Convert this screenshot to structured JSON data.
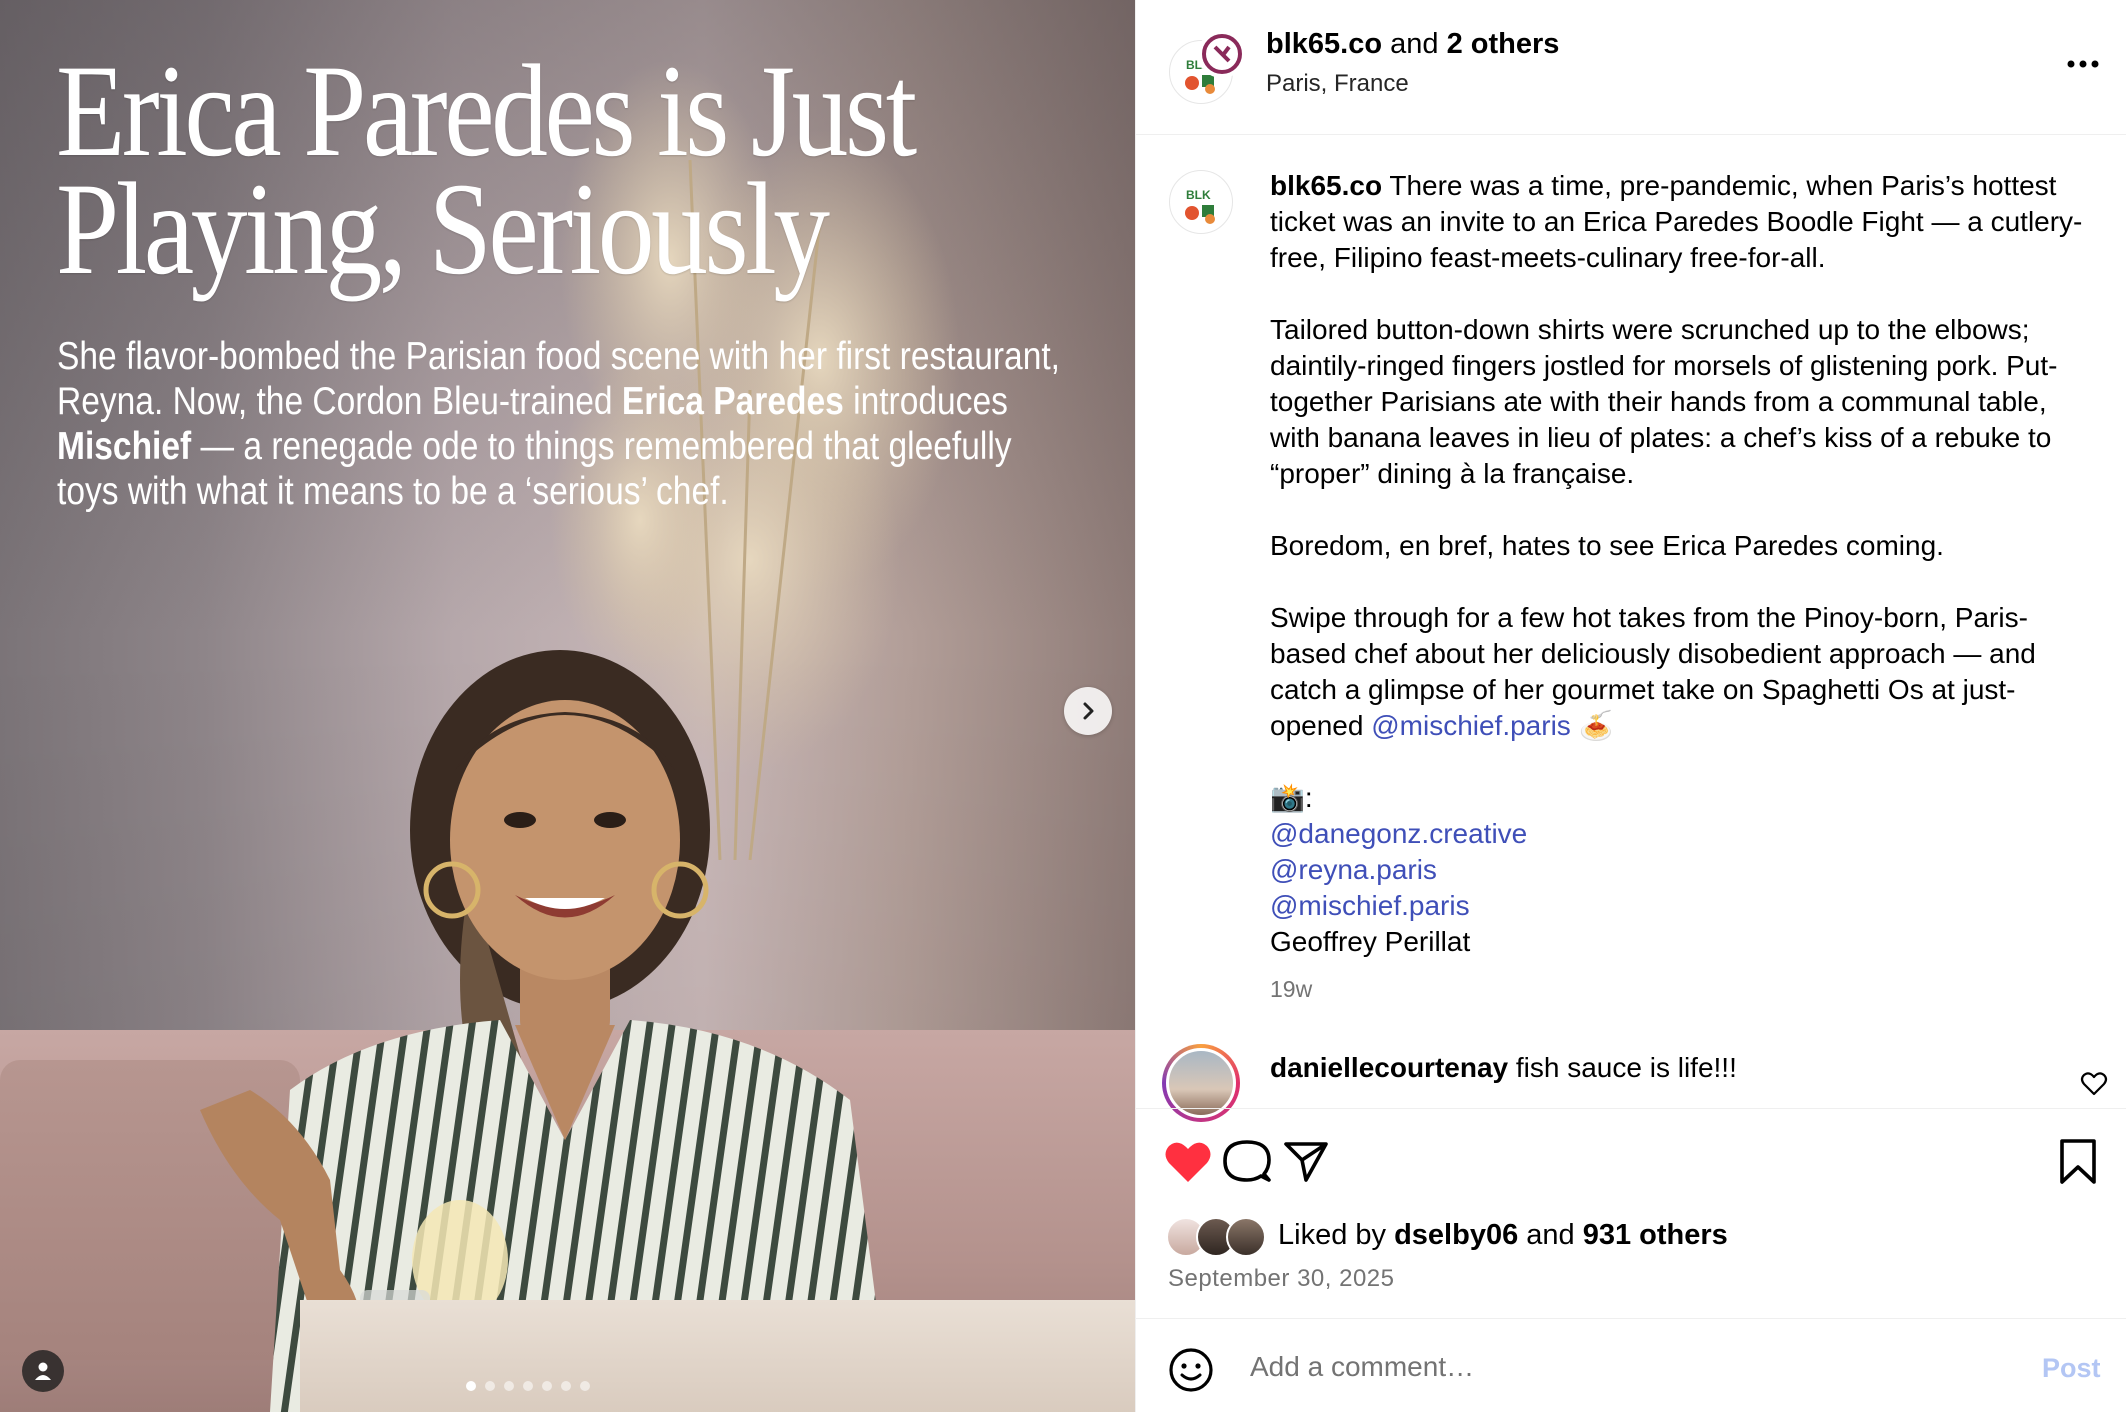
{
  "media": {
    "headline": "Erica Paredes is Just Playing, Seriously",
    "deck_parts": [
      "She flavor-bombed the Parisian food scene with her first restaurant, Reyna. Now, the Cordon Bleu-trained ",
      "Erica Paredes",
      " introduces ",
      "Mischief",
      " — a renegade ode to things remembered that gleefully toys with what it means to be a ‘serious’ chef."
    ],
    "carousel": {
      "total": 7,
      "active": 1
    }
  },
  "header": {
    "username": "blk65.co",
    "joiner": " and ",
    "others": "2 others",
    "location": "Paris, France",
    "avatar_text": "BLK"
  },
  "caption": {
    "username": "blk65.co",
    "paragraphs": [
      "There was a time, pre-pandemic, when Paris’s hottest ticket was an invite to an Erica Paredes Boodle Fight — a cutlery-free, Filipino feast-meets-culinary free-for-all.",
      "Tailored button-down shirts were scrunched up to the elbows; daintily-ringed fingers jostled for morsels of glistening pork. Put-together Parisians ate with their hands from a communal table, with banana leaves in lieu of plates: a chef’s kiss of a rebuke to “proper” dining à la française.",
      "Boredom, en bref, hates to see Erica Paredes coming.",
      "Swipe through for a few hot takes from the Pinoy-born, Paris-based chef about her deliciously disobedient approach — and catch a glimpse of her gourmet take on Spaghetti Os at just-opened "
    ],
    "mention_inline": "@mischief.paris",
    "emoji_inline": "🍝",
    "credits_label": "📸:",
    "credits": [
      "@danegonz.creative",
      "@reyna.paris",
      "@mischief.paris"
    ],
    "credit_plain": "Geoffrey Perillat",
    "time_ago": "19w"
  },
  "comment": {
    "username": "daniellecourtenay",
    "text": " fish sauce is life!!!"
  },
  "actions": {
    "liked_by_prefix": "Liked by ",
    "liked_by_user": "dselby06",
    "liked_by_joiner": " and ",
    "liked_by_others": "931 others",
    "date": "September 30, 2025"
  },
  "comment_bar": {
    "placeholder": "Add a comment…",
    "post_label": "Post"
  },
  "colors": {
    "mention": "#3f4fb8",
    "like_red": "#ff3040",
    "post_disabled": "#b3c6f4",
    "brand_green": "#2e7d3a",
    "brand_purple": "#8a2a5a"
  },
  "icons": [
    "chevron-right-icon",
    "user-icon",
    "more-icon",
    "heart-icon",
    "comment-icon",
    "share-icon",
    "bookmark-icon",
    "emoji-icon",
    "heart-outline-icon"
  ]
}
